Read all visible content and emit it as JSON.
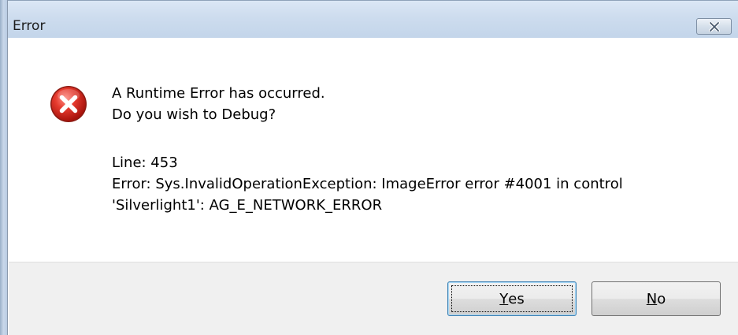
{
  "window": {
    "title": "Error"
  },
  "message": {
    "line1": "A Runtime Error has occurred.",
    "line2": "Do you wish to Debug?",
    "line3": "Line: 453",
    "line4": "Error: Sys.InvalidOperationException: ImageError error #4001 in control",
    "line5": "'Silverlight1': AG_E_NETWORK_ERROR"
  },
  "buttons": {
    "yes": {
      "accel": "Y",
      "rest": "es"
    },
    "no": {
      "accel": "N",
      "rest": "o"
    }
  },
  "icons": {
    "dialog_icon": "error-icon",
    "close": "close-icon"
  },
  "colors": {
    "error_red": "#d9261c",
    "titlebar": "#c9d9ec"
  }
}
